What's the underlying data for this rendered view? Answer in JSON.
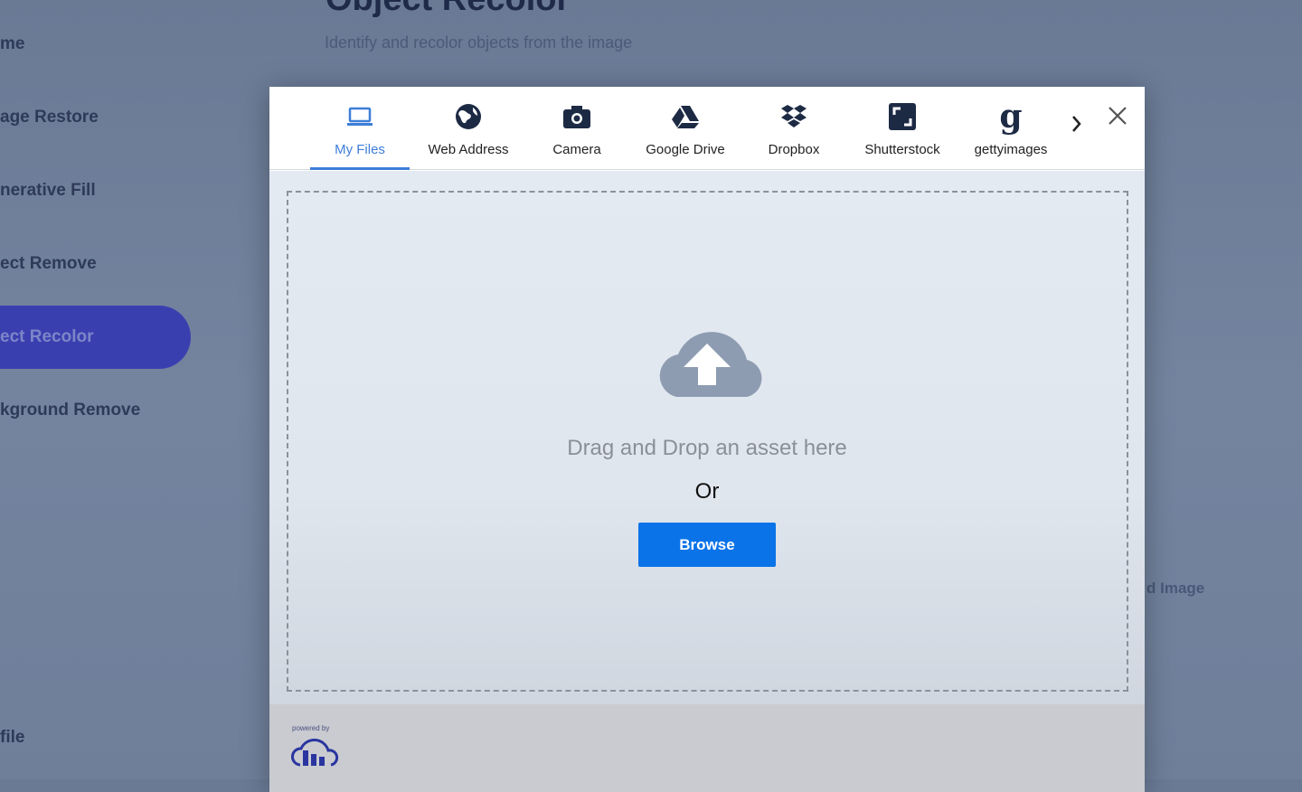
{
  "page": {
    "title": "Object Recolor",
    "subtitle": "Identify and recolor objects from the image",
    "upload_hint": "d Image"
  },
  "sidebar": {
    "items": [
      {
        "label": "me"
      },
      {
        "label": "age Restore"
      },
      {
        "label": "nerative Fill"
      },
      {
        "label": "ect Remove"
      },
      {
        "label": "ect Recolor",
        "active": true
      },
      {
        "label": "kground Remove"
      },
      {
        "label": "file"
      }
    ]
  },
  "modal": {
    "tabs": [
      {
        "label": "My Files",
        "icon": "laptop-icon",
        "active": true
      },
      {
        "label": "Web Address",
        "icon": "globe-icon"
      },
      {
        "label": "Camera",
        "icon": "camera-icon"
      },
      {
        "label": "Google Drive",
        "icon": "google-drive-icon"
      },
      {
        "label": "Dropbox",
        "icon": "dropbox-icon"
      },
      {
        "label": "Shutterstock",
        "icon": "shutterstock-icon"
      },
      {
        "label": "gettyimages",
        "icon": "gettyimages-icon"
      }
    ],
    "drop_text": "Drag and Drop an asset here",
    "or_text": "Or",
    "browse_label": "Browse",
    "powered_by": "powered by",
    "accent": "#0a73e8"
  }
}
